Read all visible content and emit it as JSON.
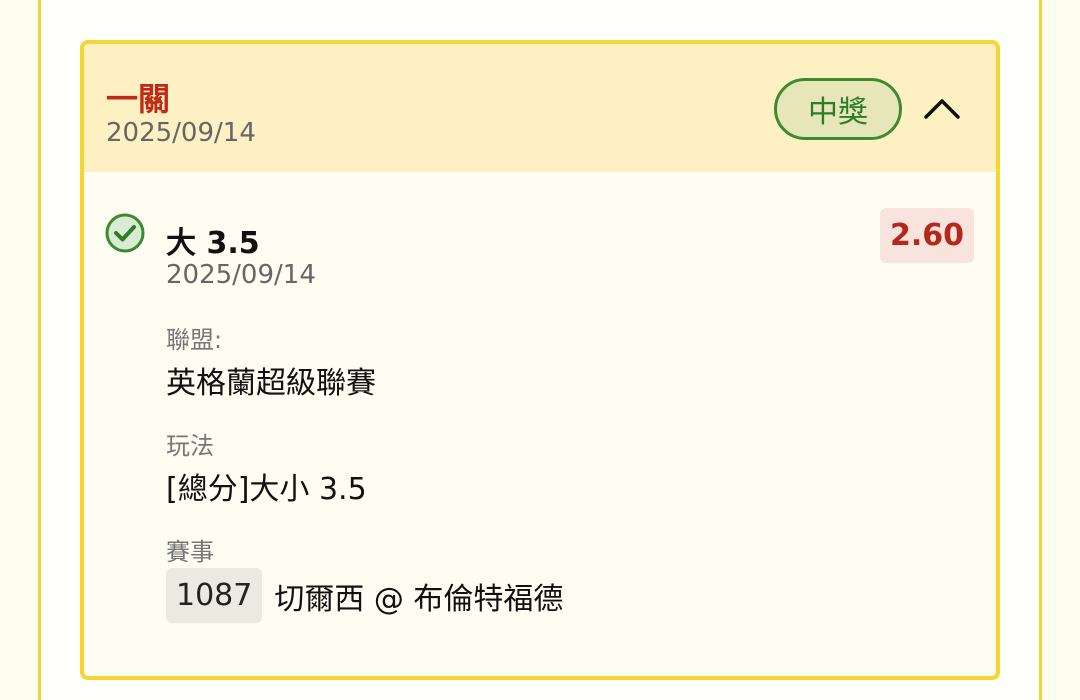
{
  "bet": {
    "type": "一關",
    "date": "2025/09/14",
    "status": "中獎",
    "colors": {
      "win": "#2c7d28",
      "accent": "#c02a18",
      "border": "#f5d531"
    }
  },
  "selection": {
    "name": "大 3.5",
    "date": "2025/09/14",
    "odds": "2.60",
    "league_label": "聯盟:",
    "league_value": "英格蘭超級聯賽",
    "play_label": "玩法",
    "play_value": "[總分]大小 3.5",
    "event_label": "賽事",
    "event_code": "1087",
    "event_name": "切爾西 @ 布倫特福德"
  },
  "icons": {
    "status": "check-circle-icon",
    "toggle": "chevron-up-icon"
  }
}
